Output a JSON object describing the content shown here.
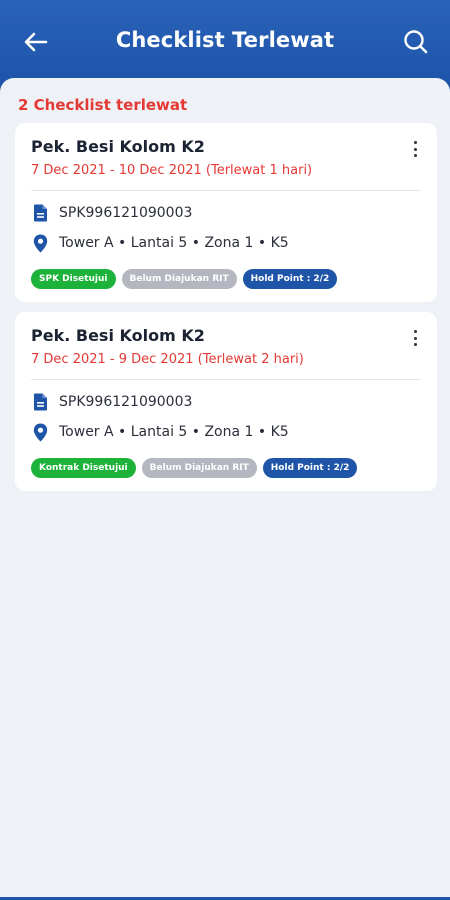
{
  "header": {
    "title": "Checklist Terlewat"
  },
  "summary": {
    "count_label": "2 Checklist terlewat"
  },
  "cards": [
    {
      "title": "Pek. Besi Kolom K2",
      "date_range": "7 Dec 2021 - 10 Dec 2021 (Terlewat 1 hari)",
      "document_no": "SPK996121090003",
      "location": "Tower A • Lantai 5 • Zona 1 • K5",
      "badges": [
        "SPK Disetujui",
        "Belum Diajukan RIT",
        "Hold Point : 2/2"
      ]
    },
    {
      "title": "Pek. Besi Kolom K2",
      "date_range": "7 Dec 2021 - 9 Dec 2021 (Terlewat 2 hari)",
      "document_no": "SPK996121090003",
      "location": "Tower A • Lantai 5 • Zona 1 • K5",
      "badges": [
        "Kontrak Disetujui",
        "Belum Diajukan RIT",
        "Hold Point : 2/2"
      ]
    }
  ],
  "colors": {
    "primary": "#1f55a8",
    "overdue": "#e53935",
    "approved": "#1db33a",
    "pending": "#b4b7bf"
  },
  "icons": {
    "back": "arrow-left-icon",
    "search": "search-icon",
    "more": "more-vertical-icon",
    "document": "document-icon",
    "location": "location-pin-icon"
  }
}
